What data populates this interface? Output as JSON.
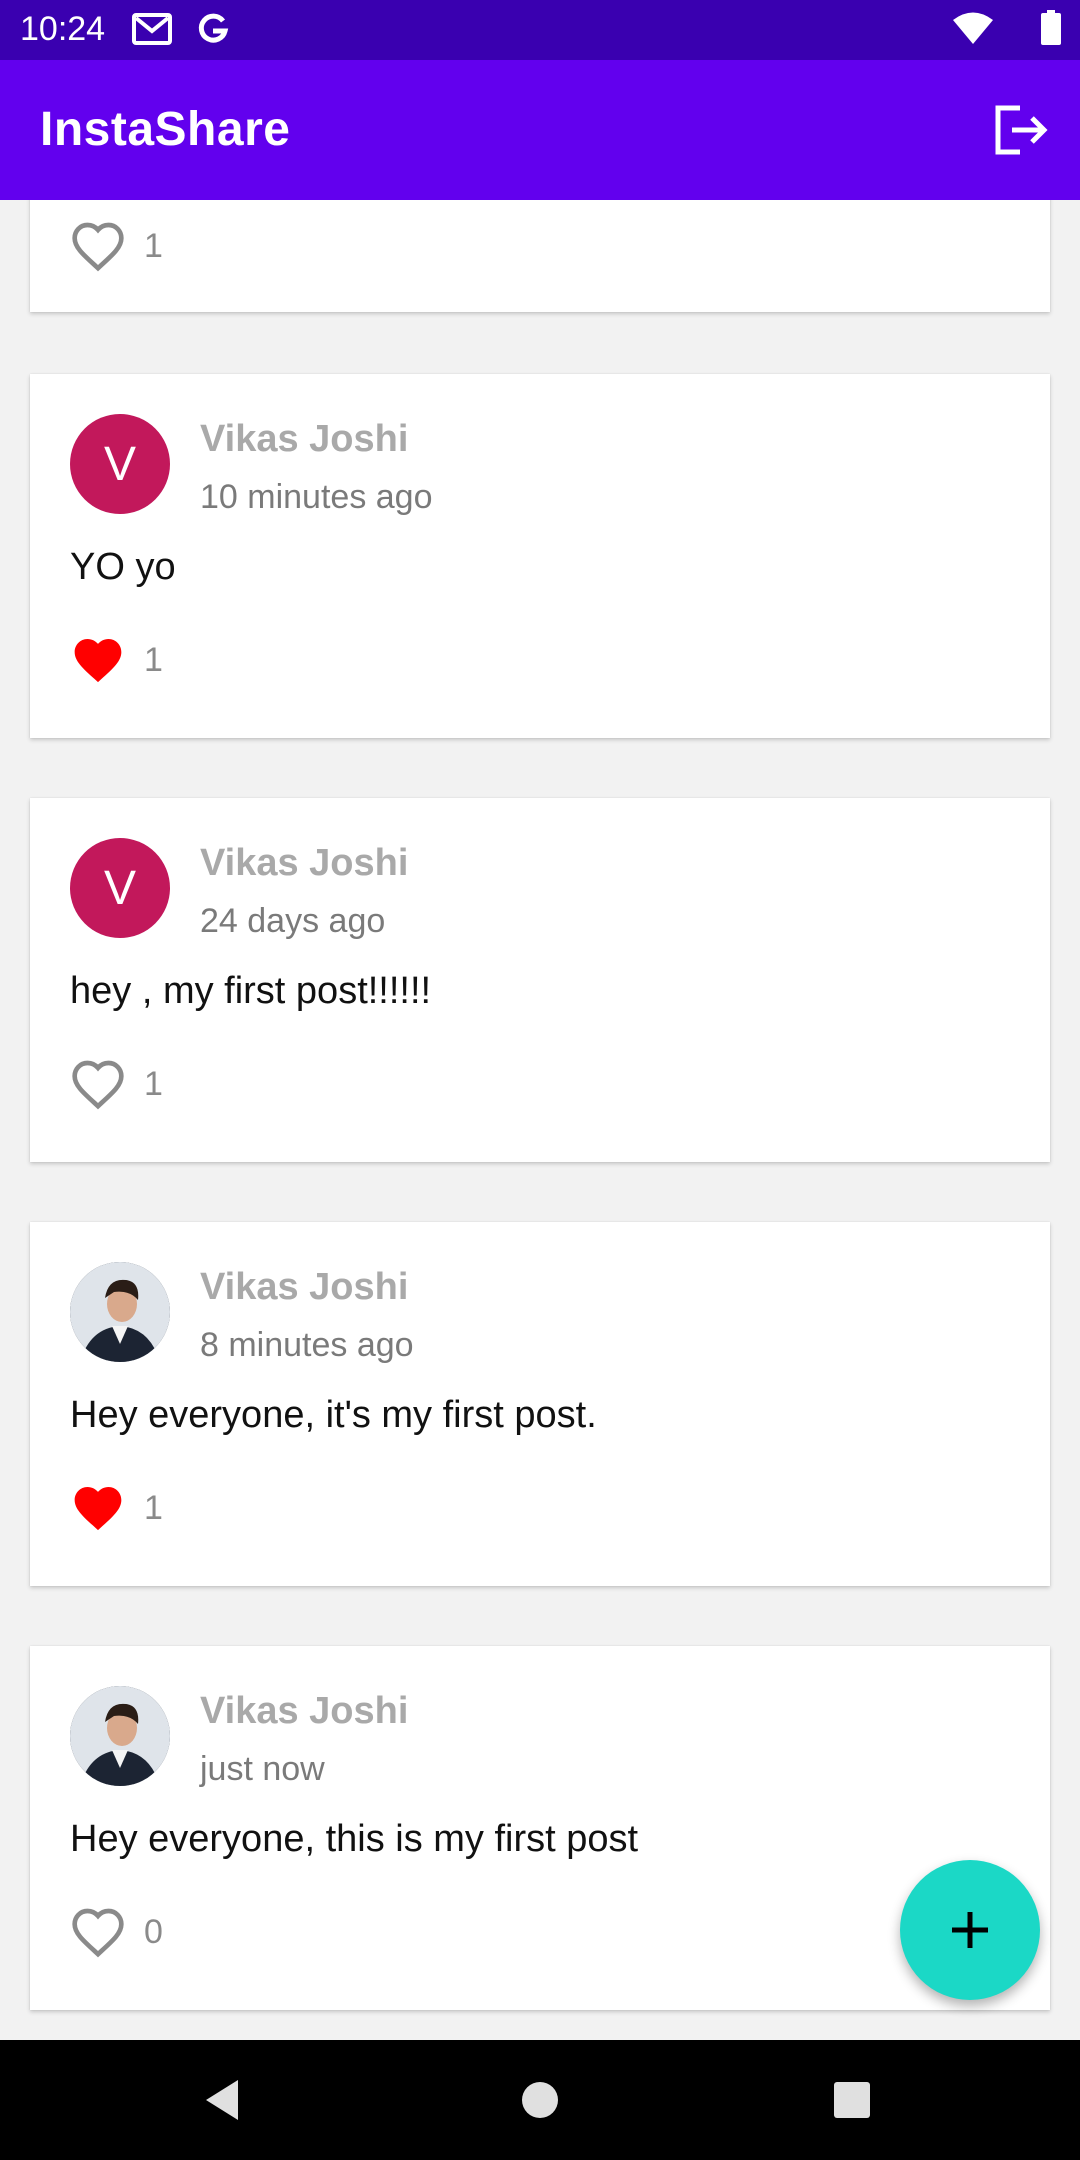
{
  "status_bar": {
    "time": "10:24",
    "left_icons": [
      "gmail-icon",
      "google-icon"
    ],
    "right_icons": [
      "wifi-icon",
      "battery-icon"
    ]
  },
  "app_bar": {
    "title": "InstaShare",
    "action_icon": "logout-icon"
  },
  "posts": [
    {
      "name": "",
      "time": "",
      "text": "",
      "likes": "1",
      "liked": false,
      "avatar": ""
    },
    {
      "name": "Vikas Joshi",
      "time": "10 minutes ago",
      "text": "YO yo",
      "likes": "1",
      "liked": true,
      "avatar": "V"
    },
    {
      "name": "Vikas Joshi",
      "time": "24 days ago",
      "text": "hey , my first post!!!!!!",
      "likes": "1",
      "liked": false,
      "avatar": "V"
    },
    {
      "name": "Vikas Joshi",
      "time": "8 minutes ago",
      "text": "Hey everyone, it's my first post.",
      "likes": "1",
      "liked": true,
      "avatar": "photo"
    },
    {
      "name": "Vikas Joshi",
      "time": "just now",
      "text": "Hey everyone, this is my first post",
      "likes": "0",
      "liked": false,
      "avatar": "photo"
    }
  ],
  "fab": {
    "icon": "plus-icon"
  },
  "nav_bar": {
    "icons": [
      "back-icon",
      "home-icon",
      "recents-icon"
    ]
  },
  "colors": {
    "status_bar": "#3a00b0",
    "app_bar": "#6200ee",
    "avatar_letter_bg": "#c2185b",
    "liked_heart": "#ff0000",
    "fab": "#1bd8c6"
  }
}
